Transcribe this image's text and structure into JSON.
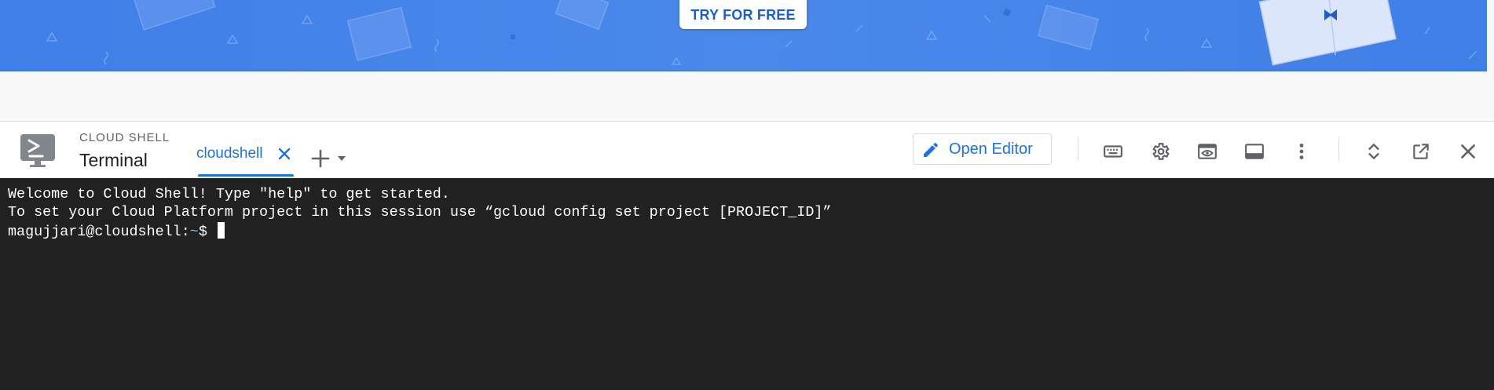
{
  "banner": {
    "cta_label": "TRY FOR FREE",
    "background": "#4a89ea",
    "cta_text_color": "#1a5fd0"
  },
  "shell": {
    "kicker": "CLOUD SHELL",
    "title": "Terminal",
    "logo_icon": "terminal-monitor-icon"
  },
  "tabs": [
    {
      "label": "cloudshell",
      "active": true
    }
  ],
  "tab_actions": {
    "add_icon": "plus-icon",
    "menu_icon": "caret-down-icon"
  },
  "toolbar": {
    "open_editor_label": "Open Editor",
    "icons": [
      "keyboard-icon",
      "settings-icon",
      "web-preview-icon",
      "terminal-panel-icon",
      "more-vert-icon",
      "expand-collapse-icon",
      "open-in-new-window-icon",
      "close-icon"
    ]
  },
  "terminal": {
    "line1": "Welcome to Cloud Shell! Type \"help\" to get started.",
    "line2": "To set your Cloud Platform project in this session use “gcloud config set project [PROJECT_ID]”",
    "prompt_user": "magujjari@cloudshell:",
    "prompt_path": "~",
    "prompt_symbol": "$ "
  },
  "colors": {
    "accent": "#1a73e8",
    "terminal_bg": "#212121",
    "header_bg": "#ffffff"
  }
}
